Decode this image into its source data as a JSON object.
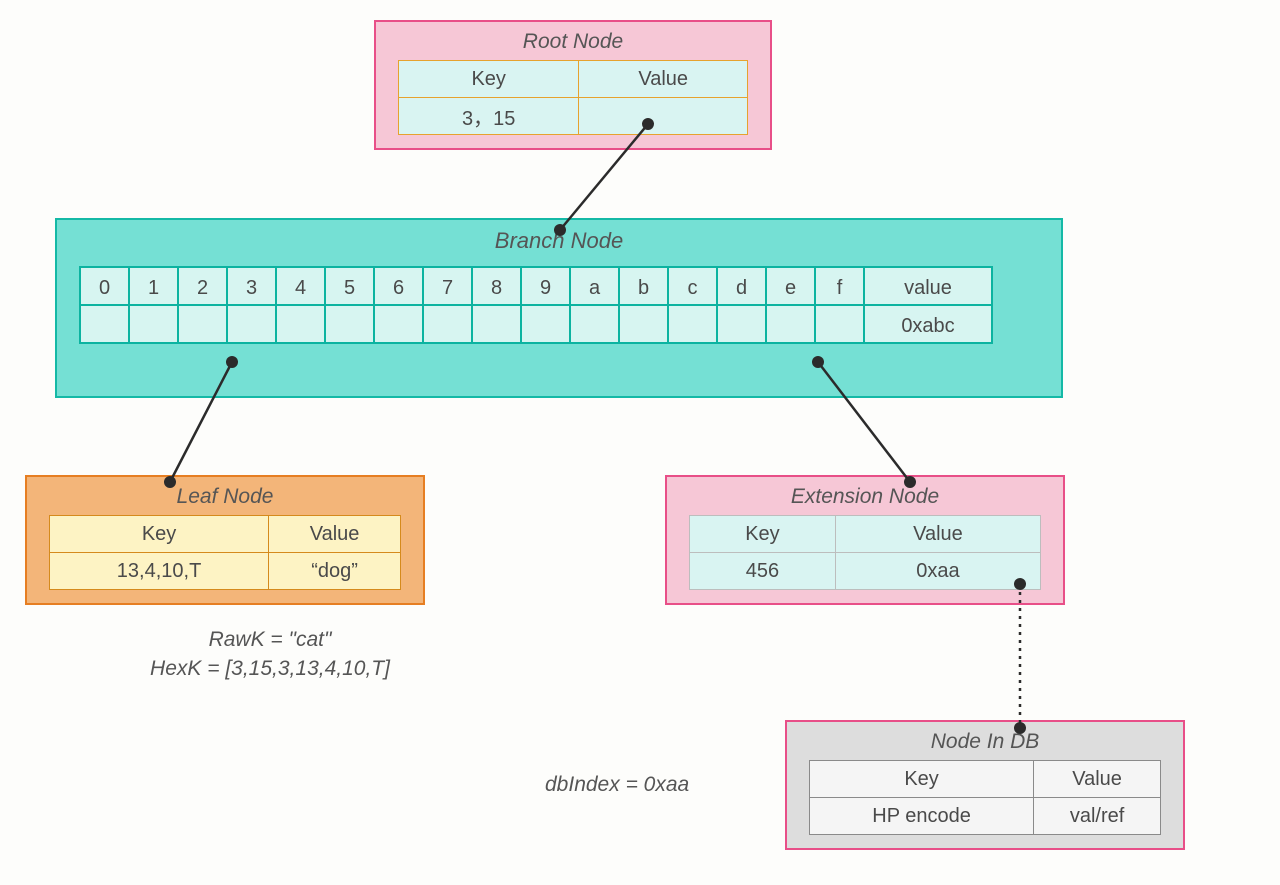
{
  "root": {
    "title": "Root Node",
    "key_header": "Key",
    "value_header": "Value",
    "key": "3，15",
    "value": ""
  },
  "branch": {
    "title": "Branch Node",
    "headers": [
      "0",
      "1",
      "2",
      "3",
      "4",
      "5",
      "6",
      "7",
      "8",
      "9",
      "a",
      "b",
      "c",
      "d",
      "e",
      "f",
      "value"
    ],
    "values": [
      "",
      "",
      "",
      "",
      "",
      "",
      "",
      "",
      "",
      "",
      "",
      "",
      "",
      "",
      "",
      "",
      "0xabc"
    ]
  },
  "leaf": {
    "title": "Leaf Node",
    "key_header": "Key",
    "value_header": "Value",
    "key": "13,4,10,T",
    "value": "“dog”"
  },
  "ext": {
    "title": "Extension Node",
    "key_header": "Key",
    "value_header": "Value",
    "key": "456",
    "value": "0xaa"
  },
  "db": {
    "title": "Node In DB",
    "key_header": "Key",
    "value_header": "Value",
    "key": "HP encode",
    "value": "val/ref"
  },
  "annot": {
    "cat_line1": "RawK = \"cat\"",
    "cat_line2": "HexK = [3,15,3,13,4,10,T]",
    "dbindex": "dbIndex = 0xaa"
  }
}
